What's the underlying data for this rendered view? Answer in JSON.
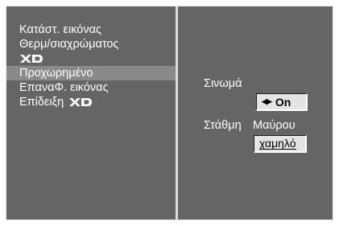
{
  "menu": {
    "items": [
      {
        "label": "Κατάστ. εικόνας",
        "selected": false
      },
      {
        "label": "Θερμ/σιαχρώματος",
        "selected": false
      },
      {
        "label": "",
        "logo": "XD-logo",
        "selected": false
      },
      {
        "label": "Προχωρημένο",
        "selected": true
      },
      {
        "label": "ΕπαναΦ. εικόνας",
        "selected": false
      },
      {
        "label": "Επίδειξη",
        "logo": "XD-logo",
        "selected": false
      }
    ]
  },
  "settings": {
    "sharpness_label": "Σινωμά",
    "sharpness_value": "On",
    "sharpness_arrows_icon": "left-right-arrows-icon",
    "black_level_label_1": "Στάθμη",
    "black_level_label_2": "Μαύρου",
    "black_level_value": "χαμηλό"
  },
  "colors": {
    "background": "#656565",
    "selected_row": "#8a8a8a",
    "text": "#ffffff",
    "value_box": "#e4e4e4"
  }
}
